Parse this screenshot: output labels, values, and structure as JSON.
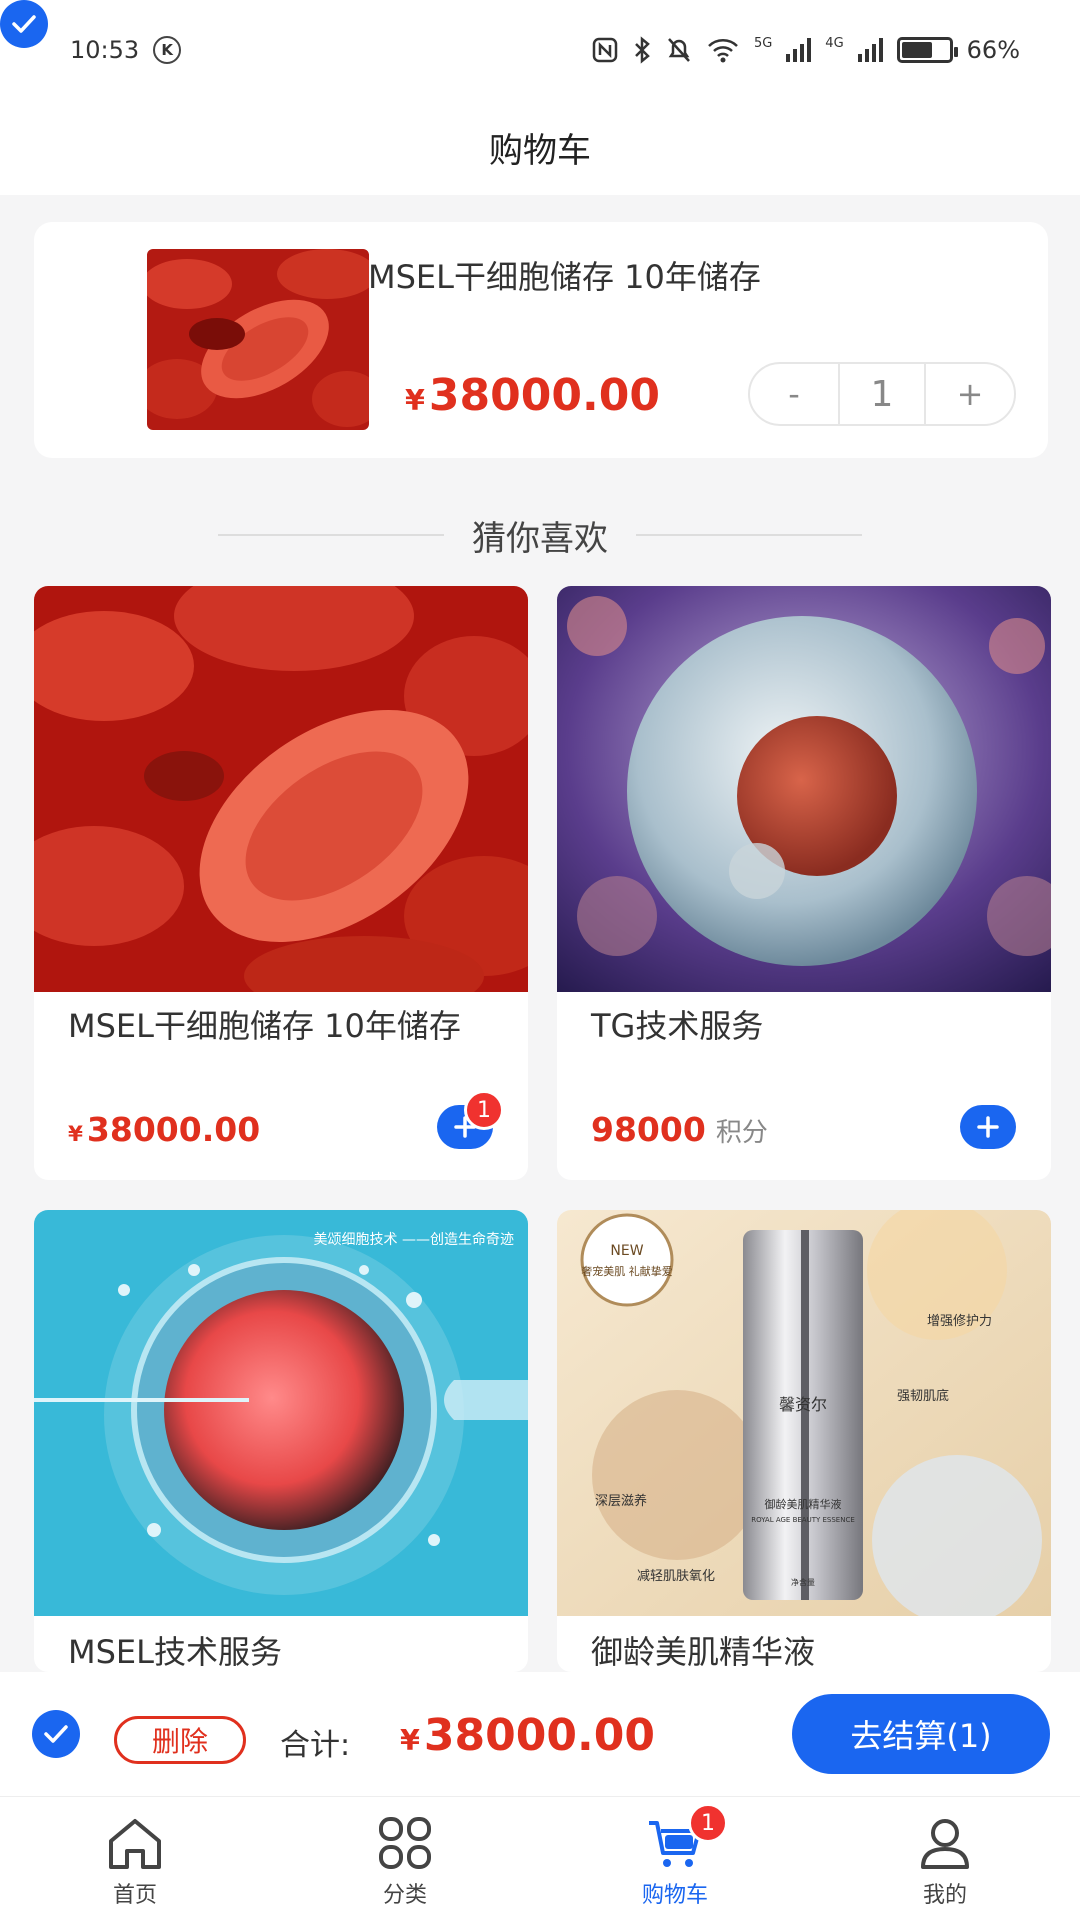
{
  "status_bar": {
    "time": "10:53",
    "k_label": "K",
    "net_5g": "5G",
    "net_4g": "4G",
    "battery": "66%",
    "battery_level": 0.66
  },
  "header": {
    "title": "购物车"
  },
  "cart_item": {
    "title": "MSEL干细胞储存 10年储存",
    "currency": "¥",
    "price": "38000.00",
    "quantity": "1",
    "minus_label": "-",
    "plus_label": "+",
    "checked": true
  },
  "recommend": {
    "title": "猜你喜欢",
    "products": [
      {
        "name": "MSEL干细胞储存 10年储存",
        "currency": "¥",
        "price": "38000.00",
        "badge": "1"
      },
      {
        "name": "TG技术服务",
        "price": "98000",
        "unit": "积分"
      },
      {
        "name": "MSEL技术服务",
        "image_caption": "美颂细胞技术 ——创造生命奇迹"
      },
      {
        "name": "御龄美肌精华液",
        "image_texts": {
          "new": "NEW",
          "new_sub": "奢宠美肌 礼献挚爱",
          "brand": "馨资尔",
          "product": "御龄美肌精华液",
          "product_en": "ROYAL AGE BEAUTY ESSENCE",
          "net": "净含量",
          "f1": "增强修护力",
          "f2": "强韧肌底",
          "f3": "深层滋养",
          "f4": "减轻肌肤氧化"
        }
      }
    ]
  },
  "checkout": {
    "delete_label": "删除",
    "total_label": "合计:",
    "currency": "¥",
    "total_price": "38000.00",
    "checkout_label": "去结算(1)"
  },
  "tabbar": {
    "items": [
      {
        "label": "首页",
        "icon": "home-icon"
      },
      {
        "label": "分类",
        "icon": "grid-icon"
      },
      {
        "label": "购物车",
        "icon": "cart-icon",
        "badge": "1",
        "active": true
      },
      {
        "label": "我的",
        "icon": "user-icon"
      }
    ]
  },
  "colors": {
    "accent": "#1a66f0",
    "price": "#e0301e",
    "badge": "#f0322f",
    "background": "#f5f5f6"
  }
}
